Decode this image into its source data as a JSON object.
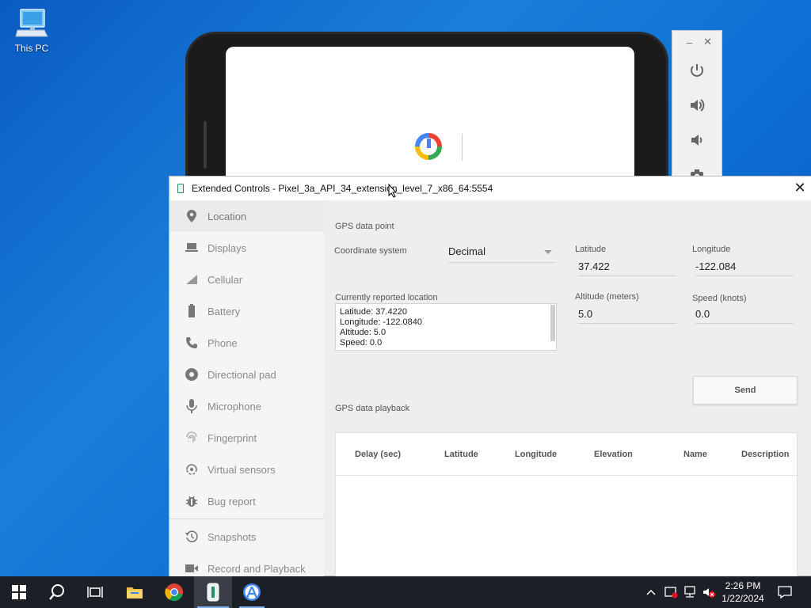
{
  "desktop": {
    "this_pc_label": "This PC"
  },
  "window": {
    "title": "Extended Controls - Pixel_3a_API_34_extension_level_7_x86_64:5554",
    "close_glyph": "✕"
  },
  "sidebar": {
    "items": [
      {
        "label": "Location",
        "icon": "location-pin-icon"
      },
      {
        "label": "Displays",
        "icon": "monitor-icon"
      },
      {
        "label": "Cellular",
        "icon": "signal-icon"
      },
      {
        "label": "Battery",
        "icon": "battery-icon"
      },
      {
        "label": "Phone",
        "icon": "phone-icon"
      },
      {
        "label": "Directional pad",
        "icon": "dpad-icon"
      },
      {
        "label": "Microphone",
        "icon": "microphone-icon"
      },
      {
        "label": "Fingerprint",
        "icon": "fingerprint-icon"
      },
      {
        "label": "Virtual sensors",
        "icon": "rotate-icon"
      },
      {
        "label": "Bug report",
        "icon": "bug-icon"
      },
      {
        "label": "Snapshots",
        "icon": "history-icon"
      },
      {
        "label": "Record and Playback",
        "icon": "video-camera-icon"
      }
    ]
  },
  "gps": {
    "section_title": "GPS data point",
    "coord_system_label": "Coordinate system",
    "coord_system_value": "Decimal",
    "latitude_label": "Latitude",
    "latitude_value": "37.422",
    "longitude_label": "Longitude",
    "longitude_value": "-122.084",
    "altitude_label": "Altitude (meters)",
    "altitude_value": "5.0",
    "speed_label": "Speed (knots)",
    "speed_value": "0.0",
    "reported_label": "Currently reported location",
    "reported_lines": [
      "Latitude: 37.4220",
      "Longitude: -122.0840",
      "Altitude: 5.0",
      "Speed: 0.0"
    ],
    "send_label": "Send"
  },
  "playback": {
    "section_title": "GPS data playback",
    "columns": [
      "Delay (sec)",
      "Latitude",
      "Longitude",
      "Elevation",
      "Name",
      "Description"
    ]
  },
  "taskbar": {
    "time": "2:26 PM",
    "date": "1/22/2024"
  }
}
